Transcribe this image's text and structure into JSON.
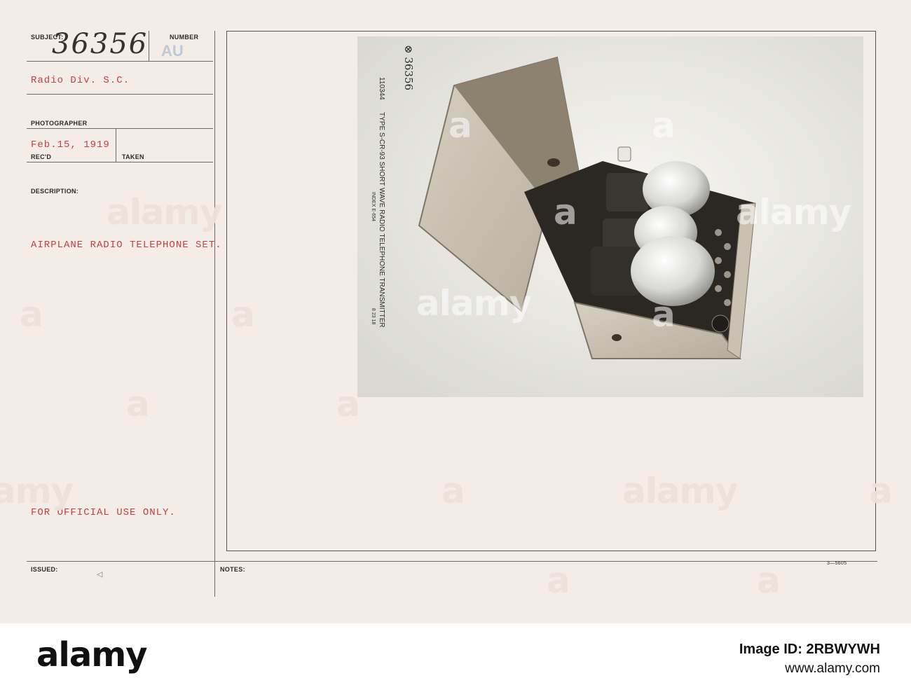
{
  "card": {
    "subject_label": "SUBJECT:",
    "subject_number": "36356",
    "number_label": "NUMBER",
    "number_value": "AU",
    "subject_line": "Radio Div. S.C.",
    "photographer_label": "PHOTOGRAPHER",
    "date_received": "Feb.15, 1919",
    "recd_label": "REC'D",
    "taken_label": "TAKEN",
    "description_label": "DESCRIPTION:",
    "description": "AIRPLANE RADIO TELEPHONE SET.",
    "official_notice": "FOR OFFICIAL USE ONLY.",
    "issued_label": "ISSUED:",
    "notes_label": "NOTES:",
    "form_number": "3—5605",
    "triangle_mark": "◁"
  },
  "photo": {
    "stamp_number": "⊗ 36356",
    "index_number": "110344",
    "caption": "TYPE S-CR-93 SHORT WAVE RADIO TELEPHONE TRANSMITTER",
    "index_ref": "INDEX E-654",
    "caption_date": "8 23 18"
  },
  "watermark": {
    "text": "alamy",
    "letter": "a"
  },
  "footer": {
    "logo": "alamy",
    "image_id_label": "Image ID: 2RBWYWH",
    "website": "www.alamy.com"
  },
  "colors": {
    "card_background": "#f4ece6",
    "typed_text": "#c0413f",
    "au_stamp": "#bfc9d6"
  }
}
